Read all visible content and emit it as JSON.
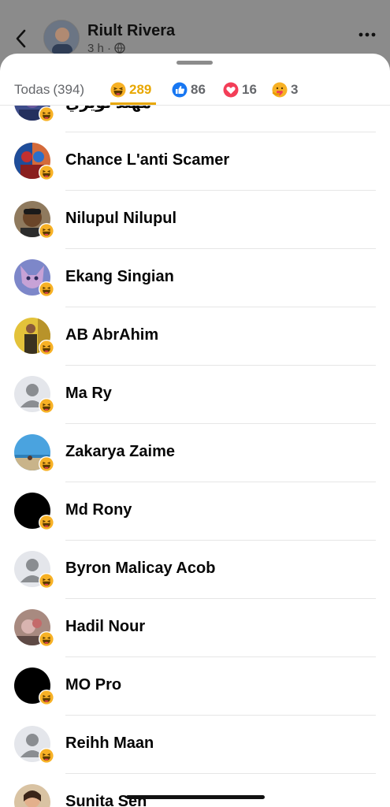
{
  "post": {
    "author": "Riult Rivera",
    "time": "3 h ·",
    "icons": [
      "back-chevron-icon",
      "globe-icon",
      "more-icon"
    ]
  },
  "tabs": {
    "all_label": "Todas",
    "all_count": "(394)",
    "haha_count": "289",
    "like_count": "86",
    "love_count": "16",
    "care_count": "3",
    "active": "haha"
  },
  "reactors": [
    {
      "name": "مهند نويري",
      "avatar": "photo"
    },
    {
      "name": "Chance L'anti Scamer",
      "avatar": "photo"
    },
    {
      "name": "Nilupul Nilupul",
      "avatar": "photo"
    },
    {
      "name": "Ekang Singian",
      "avatar": "photo"
    },
    {
      "name": "AB AbrAhim",
      "avatar": "photo"
    },
    {
      "name": "Ma Ry",
      "avatar": "default"
    },
    {
      "name": "Zakarya Zaime",
      "avatar": "photo"
    },
    {
      "name": "Md Rony",
      "avatar": "black"
    },
    {
      "name": "Byron Malicay Acob",
      "avatar": "default"
    },
    {
      "name": "Hadil Nour",
      "avatar": "photo"
    },
    {
      "name": "MO Pro",
      "avatar": "black"
    },
    {
      "name": "Reihh Maan",
      "avatar": "default"
    },
    {
      "name": "Sunita Sen",
      "avatar": "photo"
    }
  ],
  "colors": {
    "haha": "#f7b125",
    "like": "#1877f2",
    "love": "#f33e58",
    "active_tab": "#e8a700"
  }
}
